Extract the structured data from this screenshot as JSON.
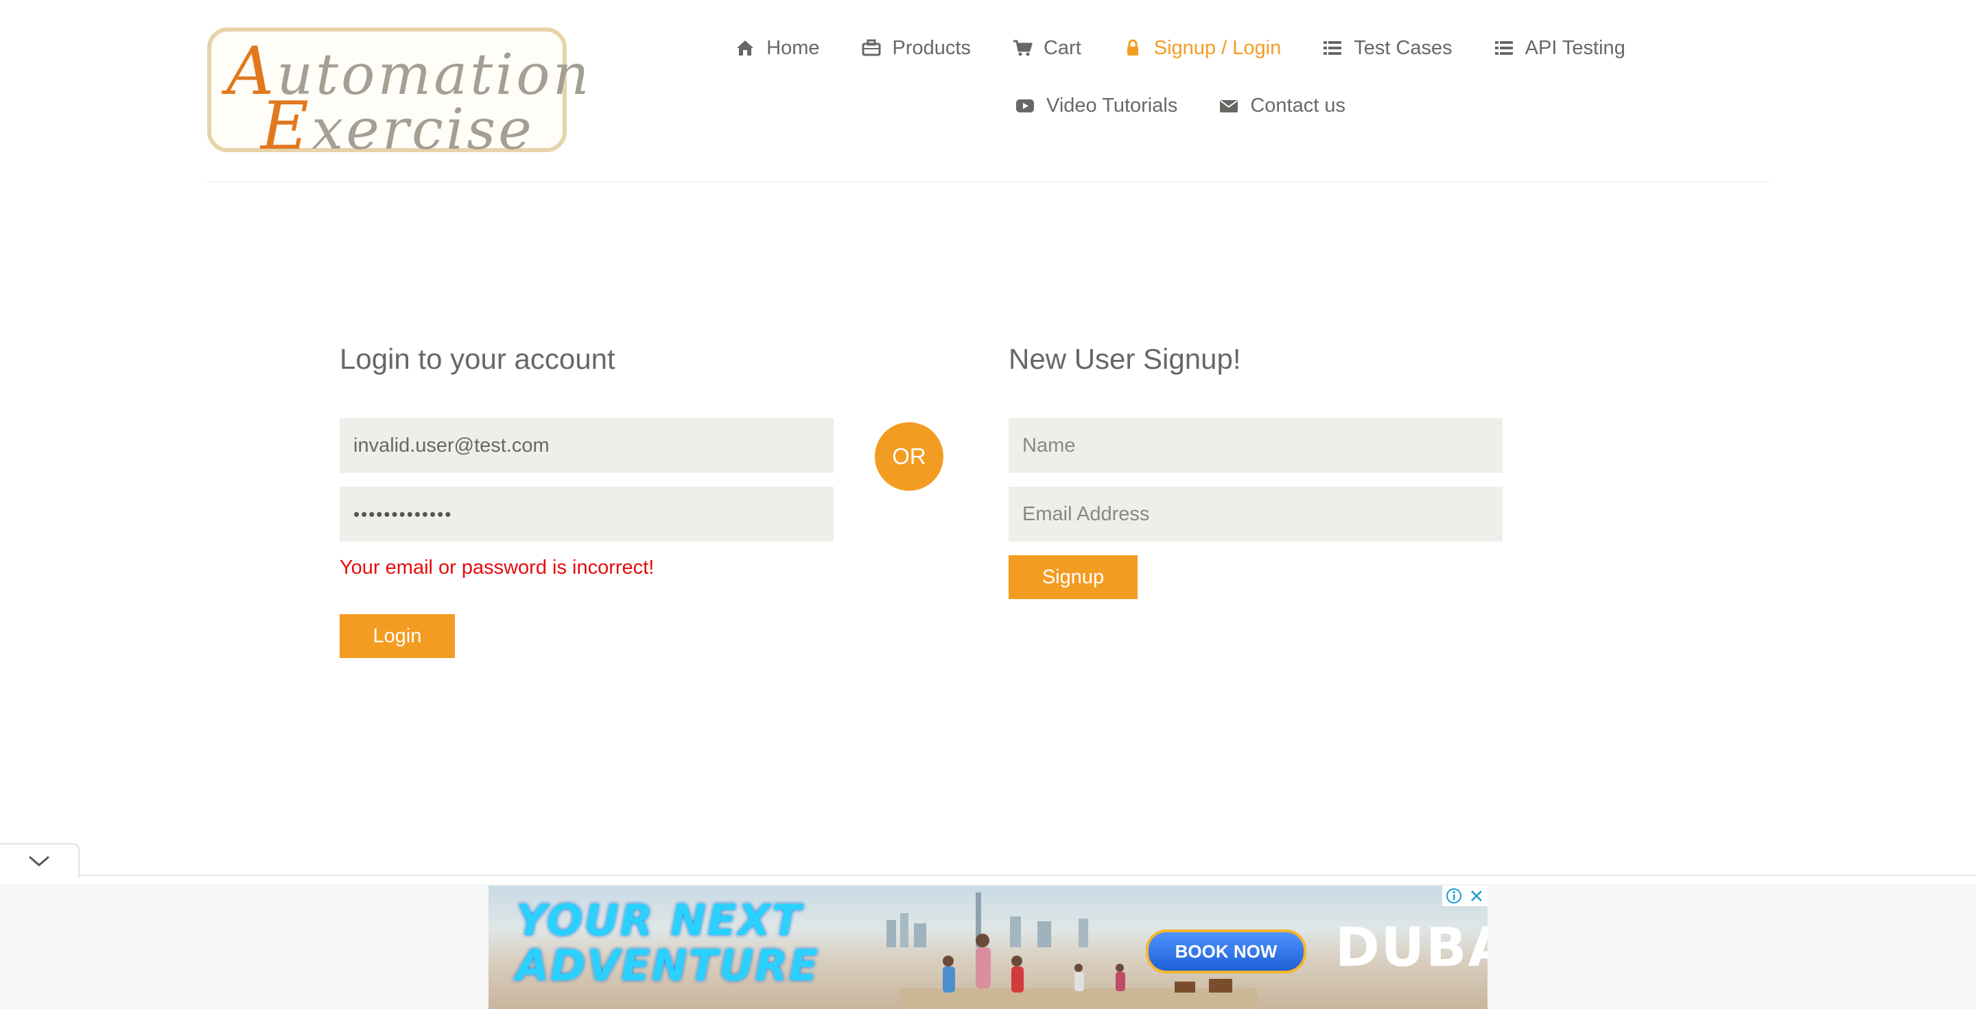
{
  "colors": {
    "accent": "#f39c22",
    "text": "#696763",
    "input_bg": "#eeeeea",
    "error": "#e60b0b"
  },
  "logo": {
    "line1_cap": "A",
    "line1_rest": "utomation",
    "line2_cap": "E",
    "line2_rest": "xercise"
  },
  "nav": [
    {
      "label": "Home",
      "icon": "home-icon"
    },
    {
      "label": "Products",
      "icon": "briefcase-icon"
    },
    {
      "label": "Cart",
      "icon": "cart-icon"
    },
    {
      "label": "Signup / Login",
      "icon": "lock-icon",
      "active": true
    },
    {
      "label": "Test Cases",
      "icon": "list-icon"
    },
    {
      "label": "API Testing",
      "icon": "list-icon"
    },
    {
      "label": "Video Tutorials",
      "icon": "youtube-play-icon"
    },
    {
      "label": "Contact us",
      "icon": "envelope-icon"
    }
  ],
  "login": {
    "title": "Login to your account",
    "email_value": "invalid.user@test.com",
    "password_value": "•••••••••••••",
    "error": "Your email or password is incorrect!",
    "button": "Login"
  },
  "or_label": "OR",
  "signup": {
    "title": "New User Signup!",
    "name_placeholder": "Name",
    "email_placeholder": "Email Address",
    "button": "Signup"
  },
  "ad": {
    "headline": "YOUR NEXT\nADVENTURE",
    "cta": "BOOK NOW",
    "brand": "DUBAI",
    "icons": [
      "ad-choices-icon",
      "close-icon"
    ]
  }
}
